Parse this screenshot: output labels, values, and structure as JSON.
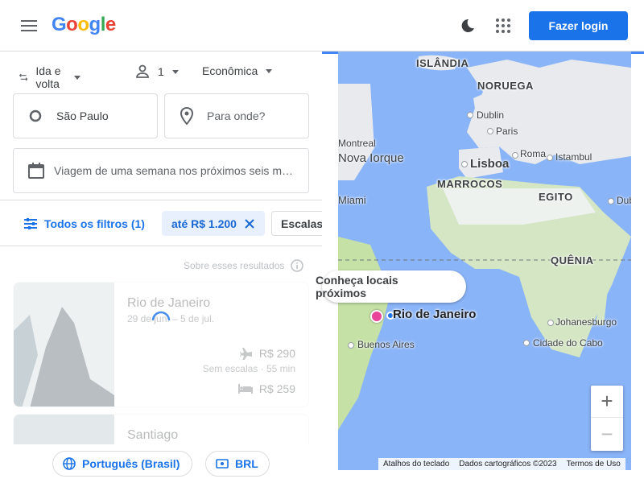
{
  "header": {
    "logo": [
      "G",
      "o",
      "o",
      "g",
      "l",
      "e"
    ],
    "logo_colors": [
      "#4285f4",
      "#ea4335",
      "#fbbc05",
      "#4285f4",
      "#34a853",
      "#ea4335"
    ],
    "login_label": "Fazer login",
    "accent": "#1a73e8"
  },
  "search": {
    "trip_type": "Ida e volta",
    "passengers": "1",
    "cabin": "Econômica",
    "origin": "São Paulo",
    "destination_placeholder": "Para onde?",
    "dates": "Viagem de uma semana nos próximos seis m…"
  },
  "filters": {
    "all_filters": "Todos os filtros (1)",
    "price_chip": "até R$ 1.200",
    "stops_chip": "Escalas"
  },
  "results": {
    "about": "Sobre esses resultados",
    "cards": [
      {
        "title": "Rio de Janeiro",
        "dates": "29 de jun. – 5 de jul.",
        "flight_price": "R$ 290",
        "flight_info": "Sem escalas · 55 min",
        "hotel_price": "R$ 259"
      },
      {
        "title": "Santiago"
      }
    ]
  },
  "footer": {
    "language": "Português (Brasil)",
    "currency": "BRL"
  },
  "map": {
    "explore_pill": "Conheça locais próximos",
    "selected_city": "Rio de Janeiro",
    "countries": [
      "ISLÂNDIA",
      "NORUEGA",
      "MARROCOS",
      "EGITO",
      "QUÊNIA"
    ],
    "cities": [
      "Dublin",
      "Paris",
      "Roma",
      "Istambul",
      "Lisboa",
      "Montreal",
      "Nova Iorque",
      "Miami",
      "Buenos Aires",
      "Johanesburgo",
      "Cidade do Cabo",
      "Dubai"
    ],
    "zoom_in": "+",
    "zoom_out": "−",
    "attribution": [
      "Atalhos do teclado",
      "Dados cartográficos ©2023",
      "Termos de Uso"
    ]
  }
}
